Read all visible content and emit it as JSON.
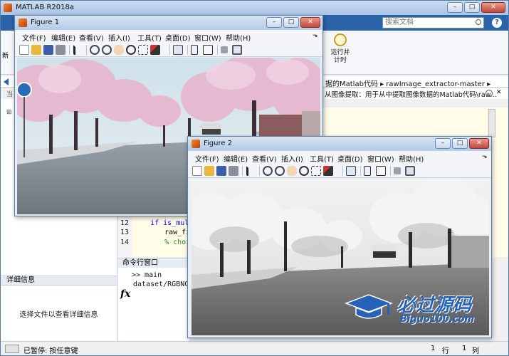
{
  "matlab": {
    "title": "MATLAB R2018a",
    "search_placeholder": "搜索文档",
    "help_label": "?",
    "ribbon": {
      "run_and_time_label": "运行并计时",
      "left_label": "新"
    },
    "path": {
      "crumbs": "据的Matlab代码 ▸ rawImage_extractor-master ▸"
    },
    "left_path_label": "当",
    "infobar_text": "从图像提取：用于从中提取图像数据的Matlab代码\\raw...",
    "details": {
      "header": "详细信息",
      "text": "选择文件以查看详细信息"
    },
    "editor": {
      "lines": [
        {
          "number": "12",
          "text": "if is_mult",
          "kind": "keyword"
        },
        {
          "number": "13",
          "text": "raw_fi",
          "kind": "code"
        },
        {
          "number": "14",
          "text": "% choi",
          "kind": "comment"
        }
      ]
    },
    "command_window": {
      "header": "命令行窗口",
      "lines": [
        ">> main",
        "dataset/RGBNC_2..."
      ],
      "fx_label": "fx"
    },
    "status": {
      "text": "已暂停: 按任意键",
      "row_label": "行",
      "row_value": "1",
      "col_label": "列",
      "col_value": "1"
    }
  },
  "figures": [
    {
      "title": "Figure 1",
      "menus": [
        "文件(F)",
        "编辑(E)",
        "查看(V)",
        "插入(I)",
        "工具(T)",
        "桌面(D)",
        "窗口(W)",
        "帮助(H)"
      ]
    },
    {
      "title": "Figure 2",
      "menus": [
        "文件(F)",
        "编辑(E)",
        "查看(V)",
        "插入(I)",
        "工具(T)",
        "桌面(D)",
        "窗口(W)",
        "帮助(H)"
      ]
    }
  ],
  "window_buttons": {
    "minimize": "–",
    "maximize": "□",
    "close": "✕"
  },
  "watermark": {
    "cn": "必过源码",
    "en": "Biguo100.com"
  },
  "colors": {
    "ribbon_tab": "#2a63a8",
    "editor_bg": "#fffce8",
    "watermark": "#2463b8"
  }
}
